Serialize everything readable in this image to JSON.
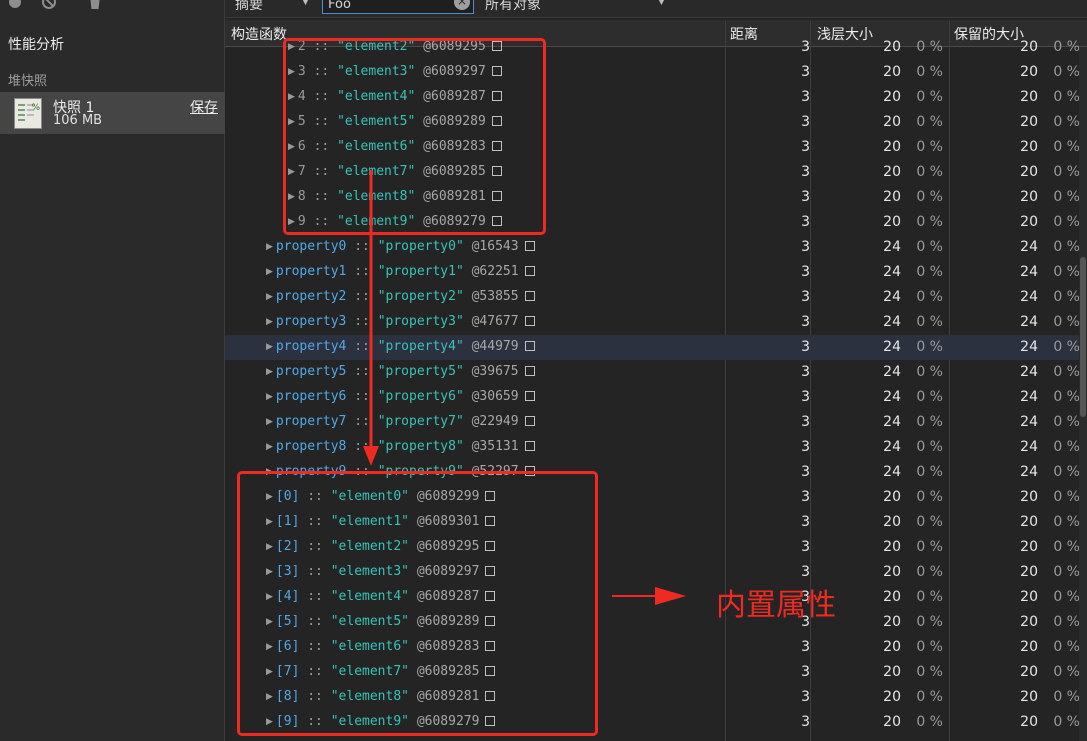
{
  "sidebar": {
    "title": "性能分析",
    "heap_section": "堆快照",
    "snapshot": {
      "title": "快照 1",
      "size": "106 MB",
      "save": "保存",
      "icon_pct": "%"
    }
  },
  "toolbar": {
    "view": "摘要",
    "filter_value": "Foo",
    "objects": "所有对象"
  },
  "columns": {
    "constructor": "构造函数",
    "distance": "距离",
    "shallow": "浅层大小",
    "retained": "保留的大小"
  },
  "annotation": {
    "label": "内置属性"
  },
  "rows": [
    {
      "indent": 1,
      "key": "2",
      "keyStyle": "index",
      "value": "\"element2\"",
      "id": "@6089295",
      "distance": "3",
      "shallow": "20",
      "shallow_pct": "0 %",
      "retained": "20",
      "retained_pct": "0 %"
    },
    {
      "indent": 1,
      "key": "3",
      "keyStyle": "index",
      "value": "\"element3\"",
      "id": "@6089297",
      "distance": "3",
      "shallow": "20",
      "shallow_pct": "0 %",
      "retained": "20",
      "retained_pct": "0 %"
    },
    {
      "indent": 1,
      "key": "4",
      "keyStyle": "index",
      "value": "\"element4\"",
      "id": "@6089287",
      "distance": "3",
      "shallow": "20",
      "shallow_pct": "0 %",
      "retained": "20",
      "retained_pct": "0 %"
    },
    {
      "indent": 1,
      "key": "5",
      "keyStyle": "index",
      "value": "\"element5\"",
      "id": "@6089289",
      "distance": "3",
      "shallow": "20",
      "shallow_pct": "0 %",
      "retained": "20",
      "retained_pct": "0 %"
    },
    {
      "indent": 1,
      "key": "6",
      "keyStyle": "index",
      "value": "\"element6\"",
      "id": "@6089283",
      "distance": "3",
      "shallow": "20",
      "shallow_pct": "0 %",
      "retained": "20",
      "retained_pct": "0 %"
    },
    {
      "indent": 1,
      "key": "7",
      "keyStyle": "index",
      "value": "\"element7\"",
      "id": "@6089285",
      "distance": "3",
      "shallow": "20",
      "shallow_pct": "0 %",
      "retained": "20",
      "retained_pct": "0 %"
    },
    {
      "indent": 1,
      "key": "8",
      "keyStyle": "index",
      "value": "\"element8\"",
      "id": "@6089281",
      "distance": "3",
      "shallow": "20",
      "shallow_pct": "0 %",
      "retained": "20",
      "retained_pct": "0 %"
    },
    {
      "indent": 1,
      "key": "9",
      "keyStyle": "index",
      "value": "\"element9\"",
      "id": "@6089279",
      "distance": "3",
      "shallow": "20",
      "shallow_pct": "0 %",
      "retained": "20",
      "retained_pct": "0 %"
    },
    {
      "indent": 0,
      "key": "property0",
      "keyStyle": "prop",
      "value": "\"property0\"",
      "id": "@16543",
      "distance": "3",
      "shallow": "24",
      "shallow_pct": "0 %",
      "retained": "24",
      "retained_pct": "0 %"
    },
    {
      "indent": 0,
      "key": "property1",
      "keyStyle": "prop",
      "value": "\"property1\"",
      "id": "@62251",
      "distance": "3",
      "shallow": "24",
      "shallow_pct": "0 %",
      "retained": "24",
      "retained_pct": "0 %"
    },
    {
      "indent": 0,
      "key": "property2",
      "keyStyle": "prop",
      "value": "\"property2\"",
      "id": "@53855",
      "distance": "3",
      "shallow": "24",
      "shallow_pct": "0 %",
      "retained": "24",
      "retained_pct": "0 %"
    },
    {
      "indent": 0,
      "key": "property3",
      "keyStyle": "prop",
      "value": "\"property3\"",
      "id": "@47677",
      "distance": "3",
      "shallow": "24",
      "shallow_pct": "0 %",
      "retained": "24",
      "retained_pct": "0 %"
    },
    {
      "indent": 0,
      "key": "property4",
      "keyStyle": "prop",
      "value": "\"property4\"",
      "id": "@44979",
      "distance": "3",
      "shallow": "24",
      "shallow_pct": "0 %",
      "retained": "24",
      "retained_pct": "0 %",
      "selected": true
    },
    {
      "indent": 0,
      "key": "property5",
      "keyStyle": "prop",
      "value": "\"property5\"",
      "id": "@39675",
      "distance": "3",
      "shallow": "24",
      "shallow_pct": "0 %",
      "retained": "24",
      "retained_pct": "0 %"
    },
    {
      "indent": 0,
      "key": "property6",
      "keyStyle": "prop",
      "value": "\"property6\"",
      "id": "@30659",
      "distance": "3",
      "shallow": "24",
      "shallow_pct": "0 %",
      "retained": "24",
      "retained_pct": "0 %"
    },
    {
      "indent": 0,
      "key": "property7",
      "keyStyle": "prop",
      "value": "\"property7\"",
      "id": "@22949",
      "distance": "3",
      "shallow": "24",
      "shallow_pct": "0 %",
      "retained": "24",
      "retained_pct": "0 %"
    },
    {
      "indent": 0,
      "key": "property8",
      "keyStyle": "prop",
      "value": "\"property8\"",
      "id": "@35131",
      "distance": "3",
      "shallow": "24",
      "shallow_pct": "0 %",
      "retained": "24",
      "retained_pct": "0 %"
    },
    {
      "indent": 0,
      "key": "property9",
      "keyStyle": "prop",
      "value": "\"property9\"",
      "id": "@52297",
      "distance": "3",
      "shallow": "24",
      "shallow_pct": "0 %",
      "retained": "24",
      "retained_pct": "0 %"
    },
    {
      "indent": 0,
      "key": "[0]",
      "keyStyle": "bracket",
      "value": "\"element0\"",
      "id": "@6089299",
      "distance": "3",
      "shallow": "20",
      "shallow_pct": "0 %",
      "retained": "20",
      "retained_pct": "0 %"
    },
    {
      "indent": 0,
      "key": "[1]",
      "keyStyle": "bracket",
      "value": "\"element1\"",
      "id": "@6089301",
      "distance": "3",
      "shallow": "20",
      "shallow_pct": "0 %",
      "retained": "20",
      "retained_pct": "0 %"
    },
    {
      "indent": 0,
      "key": "[2]",
      "keyStyle": "bracket",
      "value": "\"element2\"",
      "id": "@6089295",
      "distance": "3",
      "shallow": "20",
      "shallow_pct": "0 %",
      "retained": "20",
      "retained_pct": "0 %"
    },
    {
      "indent": 0,
      "key": "[3]",
      "keyStyle": "bracket",
      "value": "\"element3\"",
      "id": "@6089297",
      "distance": "3",
      "shallow": "20",
      "shallow_pct": "0 %",
      "retained": "20",
      "retained_pct": "0 %"
    },
    {
      "indent": 0,
      "key": "[4]",
      "keyStyle": "bracket",
      "value": "\"element4\"",
      "id": "@6089287",
      "distance": "3",
      "shallow": "20",
      "shallow_pct": "0 %",
      "retained": "20",
      "retained_pct": "0 %"
    },
    {
      "indent": 0,
      "key": "[5]",
      "keyStyle": "bracket",
      "value": "\"element5\"",
      "id": "@6089289",
      "distance": "3",
      "shallow": "20",
      "shallow_pct": "0 %",
      "retained": "20",
      "retained_pct": "0 %"
    },
    {
      "indent": 0,
      "key": "[6]",
      "keyStyle": "bracket",
      "value": "\"element6\"",
      "id": "@6089283",
      "distance": "3",
      "shallow": "20",
      "shallow_pct": "0 %",
      "retained": "20",
      "retained_pct": "0 %"
    },
    {
      "indent": 0,
      "key": "[7]",
      "keyStyle": "bracket",
      "value": "\"element7\"",
      "id": "@6089285",
      "distance": "3",
      "shallow": "20",
      "shallow_pct": "0 %",
      "retained": "20",
      "retained_pct": "0 %"
    },
    {
      "indent": 0,
      "key": "[8]",
      "keyStyle": "bracket",
      "value": "\"element8\"",
      "id": "@6089281",
      "distance": "3",
      "shallow": "20",
      "shallow_pct": "0 %",
      "retained": "20",
      "retained_pct": "0 %"
    },
    {
      "indent": 0,
      "key": "[9]",
      "keyStyle": "bracket",
      "value": "\"element9\"",
      "id": "@6089279",
      "distance": "3",
      "shallow": "20",
      "shallow_pct": "0 %",
      "retained": "20",
      "retained_pct": "0 %"
    }
  ]
}
